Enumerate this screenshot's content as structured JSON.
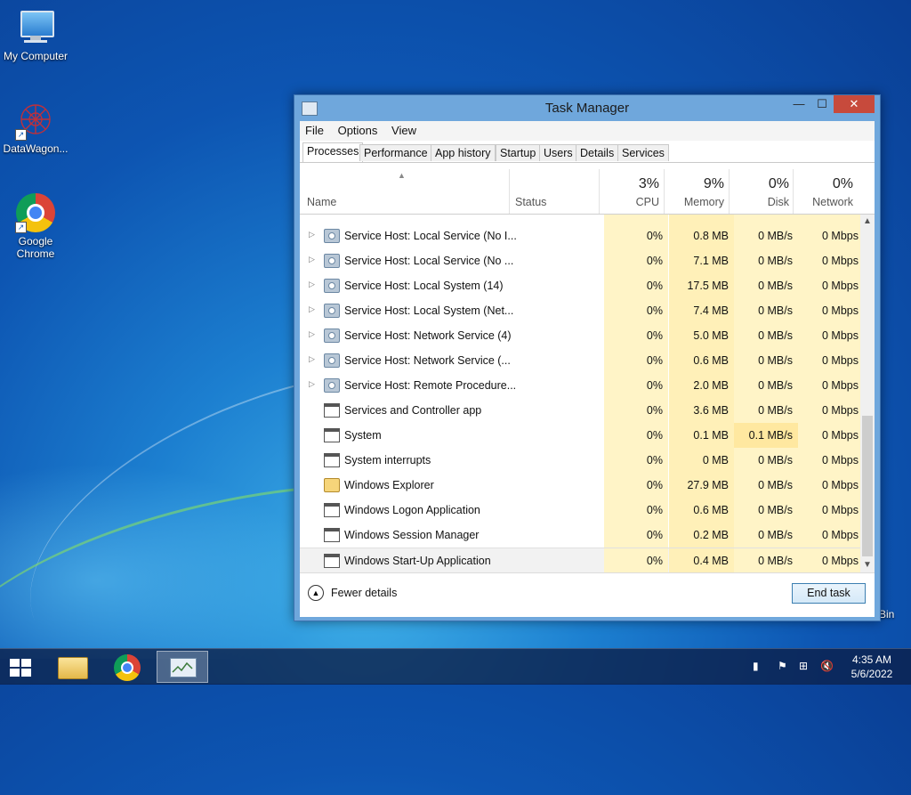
{
  "desktop": {
    "icons": [
      {
        "label": "My Computer",
        "icon": "my-computer-icon"
      },
      {
        "label": "DataWagon...",
        "icon": "datawagon-icon"
      },
      {
        "label": "Google Chrome",
        "icon": "chrome-icon"
      }
    ],
    "recycle_bin_partial": "Bin"
  },
  "window": {
    "title": "Task Manager",
    "controls": {
      "minimize": "—",
      "maximize": "☐",
      "close": "✕"
    },
    "menu": [
      "File",
      "Options",
      "View"
    ],
    "tabs": [
      "Processes",
      "Performance",
      "App history",
      "Startup",
      "Users",
      "Details",
      "Services"
    ],
    "active_tab": "Processes",
    "columns": {
      "name": "Name",
      "status": "Status",
      "cpu": {
        "pct": "3%",
        "label": "CPU"
      },
      "memory": {
        "pct": "9%",
        "label": "Memory"
      },
      "disk": {
        "pct": "0%",
        "label": "Disk"
      },
      "network": {
        "pct": "0%",
        "label": "Network"
      }
    },
    "processes": [
      {
        "name": "Service Host: Local Service (No I...",
        "cpu": "0%",
        "memory": "0.8 MB",
        "disk": "0 MB/s",
        "network": "0 Mbps",
        "icon": "gear-icon",
        "expandable": true
      },
      {
        "name": "Service Host: Local Service (No ...",
        "cpu": "0%",
        "memory": "7.1 MB",
        "disk": "0 MB/s",
        "network": "0 Mbps",
        "icon": "gear-icon",
        "expandable": true
      },
      {
        "name": "Service Host: Local System (14)",
        "cpu": "0%",
        "memory": "17.5 MB",
        "disk": "0 MB/s",
        "network": "0 Mbps",
        "icon": "gear-icon",
        "expandable": true
      },
      {
        "name": "Service Host: Local System (Net...",
        "cpu": "0%",
        "memory": "7.4 MB",
        "disk": "0 MB/s",
        "network": "0 Mbps",
        "icon": "gear-icon",
        "expandable": true
      },
      {
        "name": "Service Host: Network Service (4)",
        "cpu": "0%",
        "memory": "5.0 MB",
        "disk": "0 MB/s",
        "network": "0 Mbps",
        "icon": "gear-icon",
        "expandable": true
      },
      {
        "name": "Service Host: Network Service (...",
        "cpu": "0%",
        "memory": "0.6 MB",
        "disk": "0 MB/s",
        "network": "0 Mbps",
        "icon": "gear-icon",
        "expandable": true
      },
      {
        "name": "Service Host: Remote Procedure...",
        "cpu": "0%",
        "memory": "2.0 MB",
        "disk": "0 MB/s",
        "network": "0 Mbps",
        "icon": "gear-icon",
        "expandable": true
      },
      {
        "name": "Services and Controller app",
        "cpu": "0%",
        "memory": "3.6 MB",
        "disk": "0 MB/s",
        "network": "0 Mbps",
        "icon": "app-window-icon",
        "expandable": false
      },
      {
        "name": "System",
        "cpu": "0%",
        "memory": "0.1 MB",
        "disk": "0.1 MB/s",
        "network": "0 Mbps",
        "icon": "app-window-icon",
        "expandable": false
      },
      {
        "name": "System interrupts",
        "cpu": "0%",
        "memory": "0 MB",
        "disk": "0 MB/s",
        "network": "0 Mbps",
        "icon": "app-window-icon",
        "expandable": false
      },
      {
        "name": "Windows Explorer",
        "cpu": "0%",
        "memory": "27.9 MB",
        "disk": "0 MB/s",
        "network": "0 Mbps",
        "icon": "folder-icon",
        "expandable": false
      },
      {
        "name": "Windows Logon Application",
        "cpu": "0%",
        "memory": "0.6 MB",
        "disk": "0 MB/s",
        "network": "0 Mbps",
        "icon": "app-window-icon",
        "expandable": false
      },
      {
        "name": "Windows Session Manager",
        "cpu": "0%",
        "memory": "0.2 MB",
        "disk": "0 MB/s",
        "network": "0 Mbps",
        "icon": "app-window-icon",
        "expandable": false
      },
      {
        "name": "Windows Start-Up Application",
        "cpu": "0%",
        "memory": "0.4 MB",
        "disk": "0 MB/s",
        "network": "0 Mbps",
        "icon": "app-window-icon",
        "expandable": false,
        "selected": true
      }
    ],
    "footer": {
      "fewer_details": "Fewer details",
      "end_task": "End task"
    }
  },
  "taskbar": {
    "items": [
      "start-button",
      "file-explorer",
      "google-chrome",
      "task-manager"
    ],
    "active_item": "task-manager",
    "clock": {
      "time": "4:35 AM",
      "date": "5/6/2022"
    }
  },
  "colors": {
    "desktop_blue": "#0d55b2",
    "titlebar": "#6fa7dc",
    "close_button": "#c74a3c",
    "heat_light": "#fff4c7",
    "heat_medium": "#ffe8a0"
  }
}
